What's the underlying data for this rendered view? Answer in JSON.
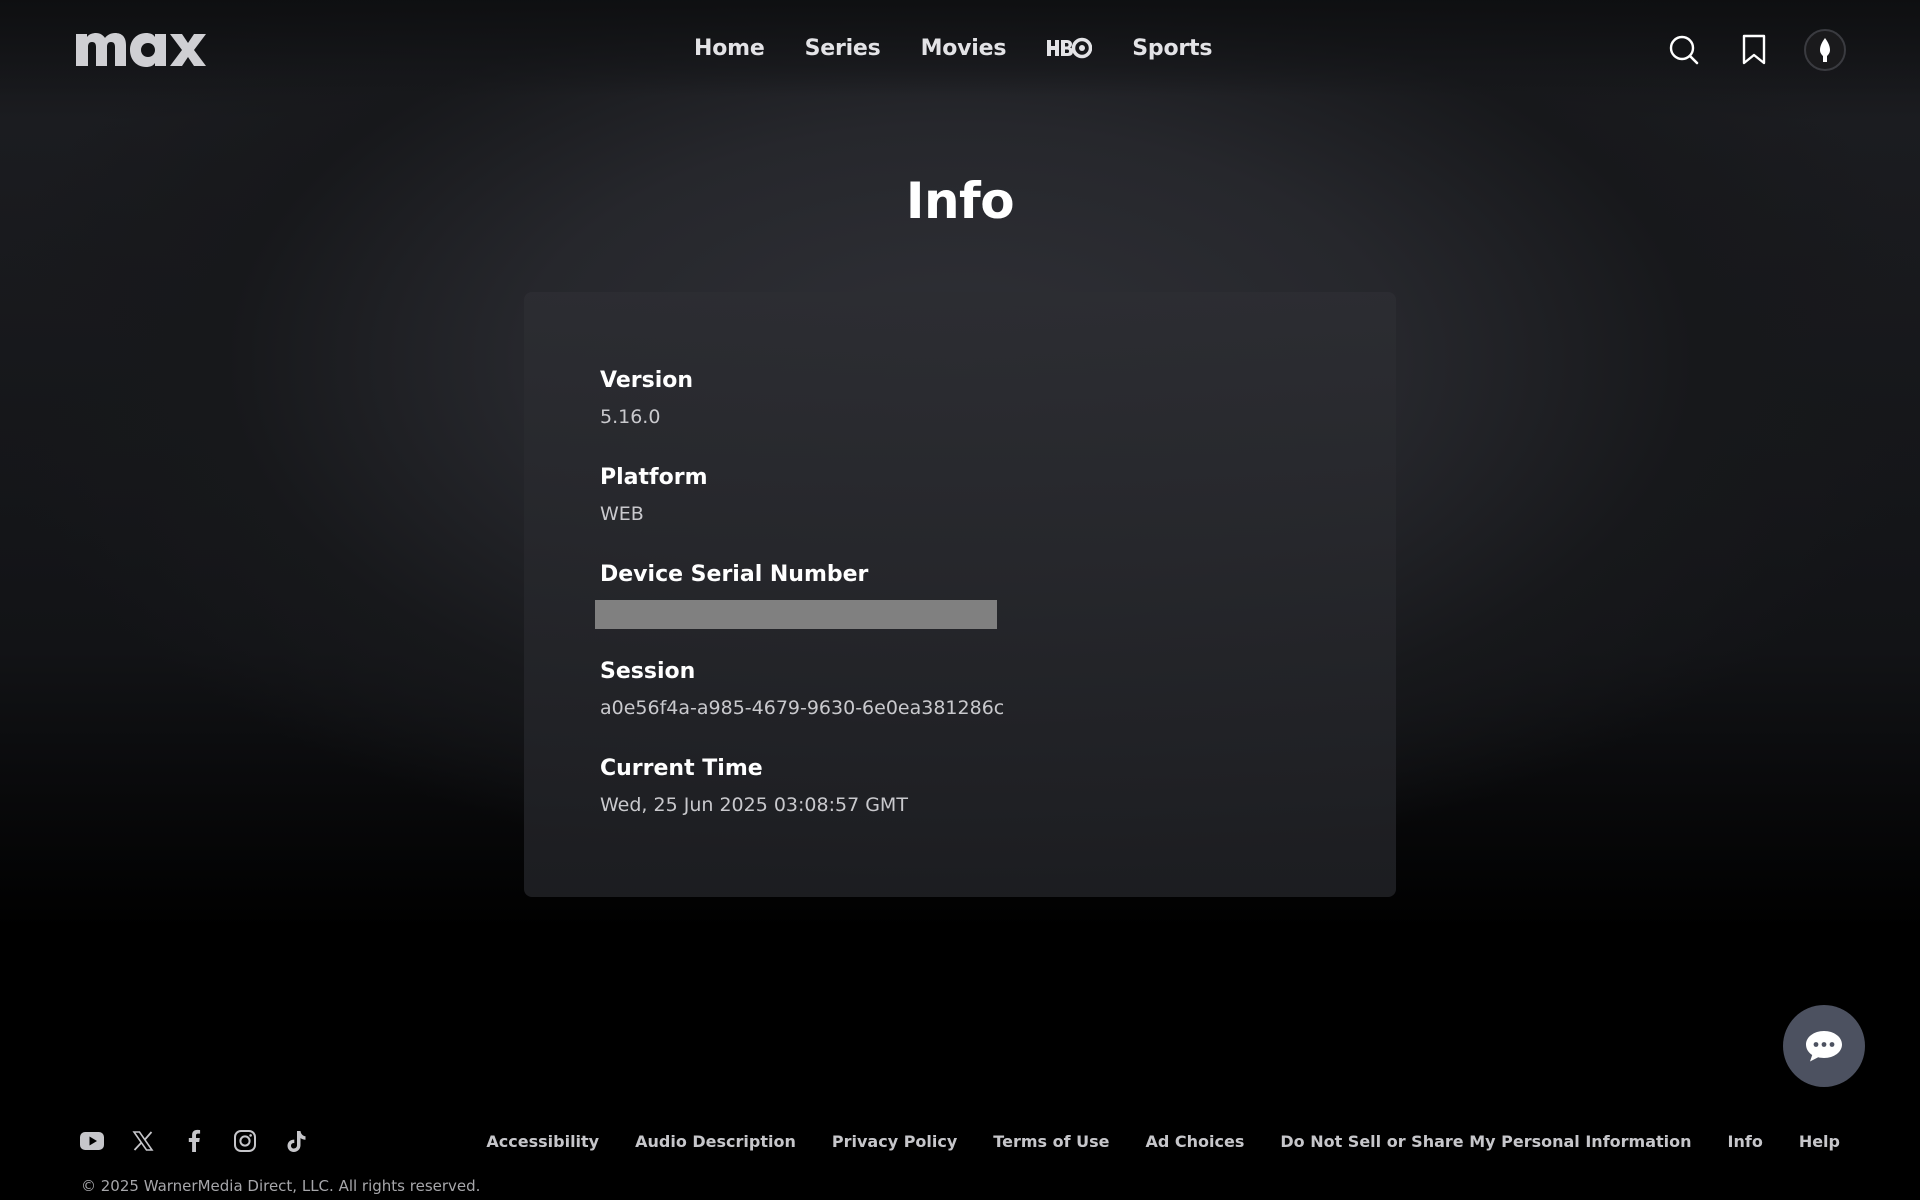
{
  "header": {
    "logo_text": "max",
    "nav": [
      {
        "label": "Home"
      },
      {
        "label": "Series"
      },
      {
        "label": "Movies"
      },
      {
        "label": "HBO",
        "icon": "hbo-logo-icon"
      },
      {
        "label": "Sports"
      }
    ],
    "icons": [
      "search-icon",
      "bookmark-icon",
      "profile-avatar"
    ]
  },
  "main": {
    "title": "Info",
    "fields": {
      "version": {
        "label": "Version",
        "value": "5.16.0"
      },
      "platform": {
        "label": "Platform",
        "value": "WEB"
      },
      "device_serial": {
        "label": "Device Serial Number",
        "redacted": true
      },
      "session": {
        "label": "Session",
        "value": "a0e56f4a-a985-4679-9630-6e0ea381286c"
      },
      "current_time": {
        "label": "Current Time",
        "value": "Wed, 25 Jun 2025 03:08:57 GMT"
      }
    }
  },
  "chat": {
    "icon": "chat-bubble-icon"
  },
  "footer": {
    "social": [
      "youtube-icon",
      "x-icon",
      "facebook-icon",
      "instagram-icon",
      "tiktok-icon"
    ],
    "links": [
      "Accessibility",
      "Audio Description",
      "Privacy Policy",
      "Terms of Use",
      "Ad Choices",
      "Do Not Sell or Share My Personal Information",
      "Info",
      "Help"
    ],
    "copyright": "© 2025 WarnerMedia Direct, LLC. All rights reserved."
  },
  "colors": {
    "background_dark": "#000000",
    "card_bg": "#2a2b30",
    "text_primary": "#ffffff",
    "text_secondary": "#c9c9cd",
    "redaction": "#808080",
    "chat_button": "#4c5160"
  }
}
